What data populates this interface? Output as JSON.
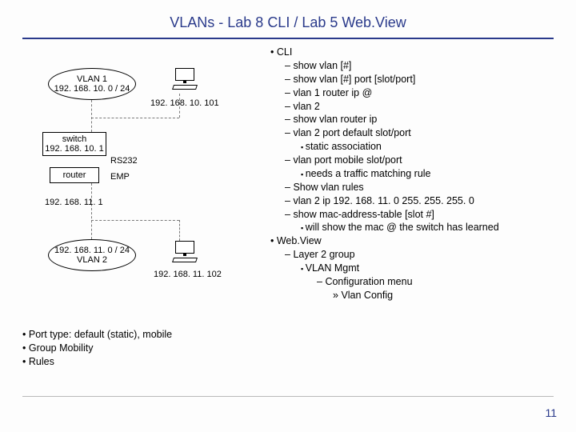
{
  "title": "VLANs - Lab 8 CLI / Lab 5 Web.View",
  "diagram": {
    "vlan1": {
      "name": "VLAN 1",
      "subnet": "192. 168. 10. 0 / 24"
    },
    "vlan2": {
      "subnet": "192. 168. 11. 0 / 24",
      "name": "VLAN 2"
    },
    "switch": {
      "label": "switch",
      "ip": "192. 168. 10. 1"
    },
    "router": {
      "label": "router"
    },
    "ip1111": "192. 168. 11. 1",
    "rs232": "RS232",
    "emp": "EMP",
    "pc_top_ip": "192. 168. 10. 101",
    "pc_bot_ip": "192. 168. 11. 102"
  },
  "cli": {
    "heading": "CLI",
    "items": [
      "show vlan [#]",
      "show vlan [#] port [slot/port]",
      "vlan 1 router ip @",
      "vlan 2",
      "show vlan router ip",
      "vlan 2 port default slot/port"
    ],
    "sub_static": "static association",
    "item7": "vlan port mobile slot/port",
    "sub_traffic": "needs a traffic matching rule",
    "items_tail": [
      "Show vlan rules",
      "vlan 2 ip 192. 168. 11. 0 255. 255. 255. 0",
      "show mac-address-table [slot #]"
    ],
    "sub_mac": "will show the mac @ the switch has learned"
  },
  "webview": {
    "heading": "Web.View",
    "l2": "Layer 2 group",
    "vlanmgmt": "VLAN Mgmt",
    "confmenu": "Configuration menu",
    "vlanconfig": "Vlan Config"
  },
  "notes": {
    "a": "Port type: default (static), mobile",
    "b": "Group Mobility",
    "c": "Rules"
  },
  "page": "11"
}
